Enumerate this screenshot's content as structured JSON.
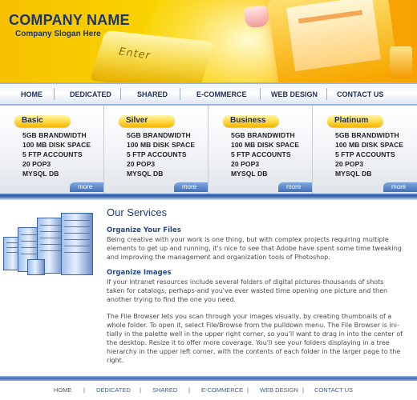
{
  "brand": {
    "name": "COMPANY NAME",
    "slogan": "Company Slogan Here",
    "colors": {
      "accent": "#f9d300",
      "navy": "#1b3570",
      "blue": "#3c67b0"
    }
  },
  "header_image": {
    "key_text": "Enter"
  },
  "nav": {
    "items": [
      "HOME",
      "DEDICATED",
      "SHARED",
      "E-COMMERCE",
      "WEB DESIGN",
      "CONTACT US"
    ]
  },
  "plans": [
    {
      "name": "Basic",
      "features": [
        "5GB BRANDWIDTH",
        "100 MB DISK SPACE",
        "5 FTP ACCOUNTS",
        "20 POP3",
        "MYSQL DB"
      ],
      "more": "more"
    },
    {
      "name": "Silver",
      "features": [
        "5GB BRANDWIDTH",
        "100 MB DISK SPACE",
        "5 FTP ACCOUNTS",
        "20 POP3",
        "MYSQL DB"
      ],
      "more": "more"
    },
    {
      "name": "Business",
      "features": [
        "5GB BRANDWIDTH",
        "100 MB DISK SPACE",
        "5 FTP ACCOUNTS",
        "20 POP3",
        "MYSQL DB"
      ],
      "more": "more"
    },
    {
      "name": "Platinum",
      "features": [
        "5GB BRANDWIDTH",
        "100 MB DISK SPACE",
        "5 FTP ACCOUNTS",
        "20 POP3",
        "MYSQL DB"
      ],
      "more": "more"
    }
  ],
  "services": {
    "title": "Our Services",
    "sections": [
      {
        "heading": "Organize Your Files",
        "lines": [
          "Being creative with your work is one thing, but with complex projects requiring multiple",
          "elements to get up and running, it's nice to see that Adobe have spent some time tweaking",
          "and improving the management and organization tools of Photoshop."
        ]
      },
      {
        "heading": "Organize Images",
        "lines": [
          "If your intranet resources include several folders of digital pictures-thousands of shots",
          "taken for catalogs, perhaps-and you've ever wasted time opening one picture and then",
          "another trying to find the one you need."
        ]
      }
    ],
    "extra_lines": [
      "The File Browser lets you scan through your images visually, by creating thumbnails of a",
      "whole folder. To open it, select File/Browse from the pulldown menu. The File Browser is ini-",
      "tially in the palette well in the upper right corner, so you'll want to drag in into the center of",
      "the desktop. Resize it to offer more coverage. You'll see your folders displaying in a tree",
      "hierarchy in the upper left corner, with the contents of each folder in the larger page to the",
      "right."
    ]
  },
  "footer": {
    "items": [
      "HOME",
      "DEDICATED",
      "SHARED",
      "E-COMMERCE",
      "WEB DESIGN",
      "CONTACT US"
    ],
    "separator": "|"
  }
}
